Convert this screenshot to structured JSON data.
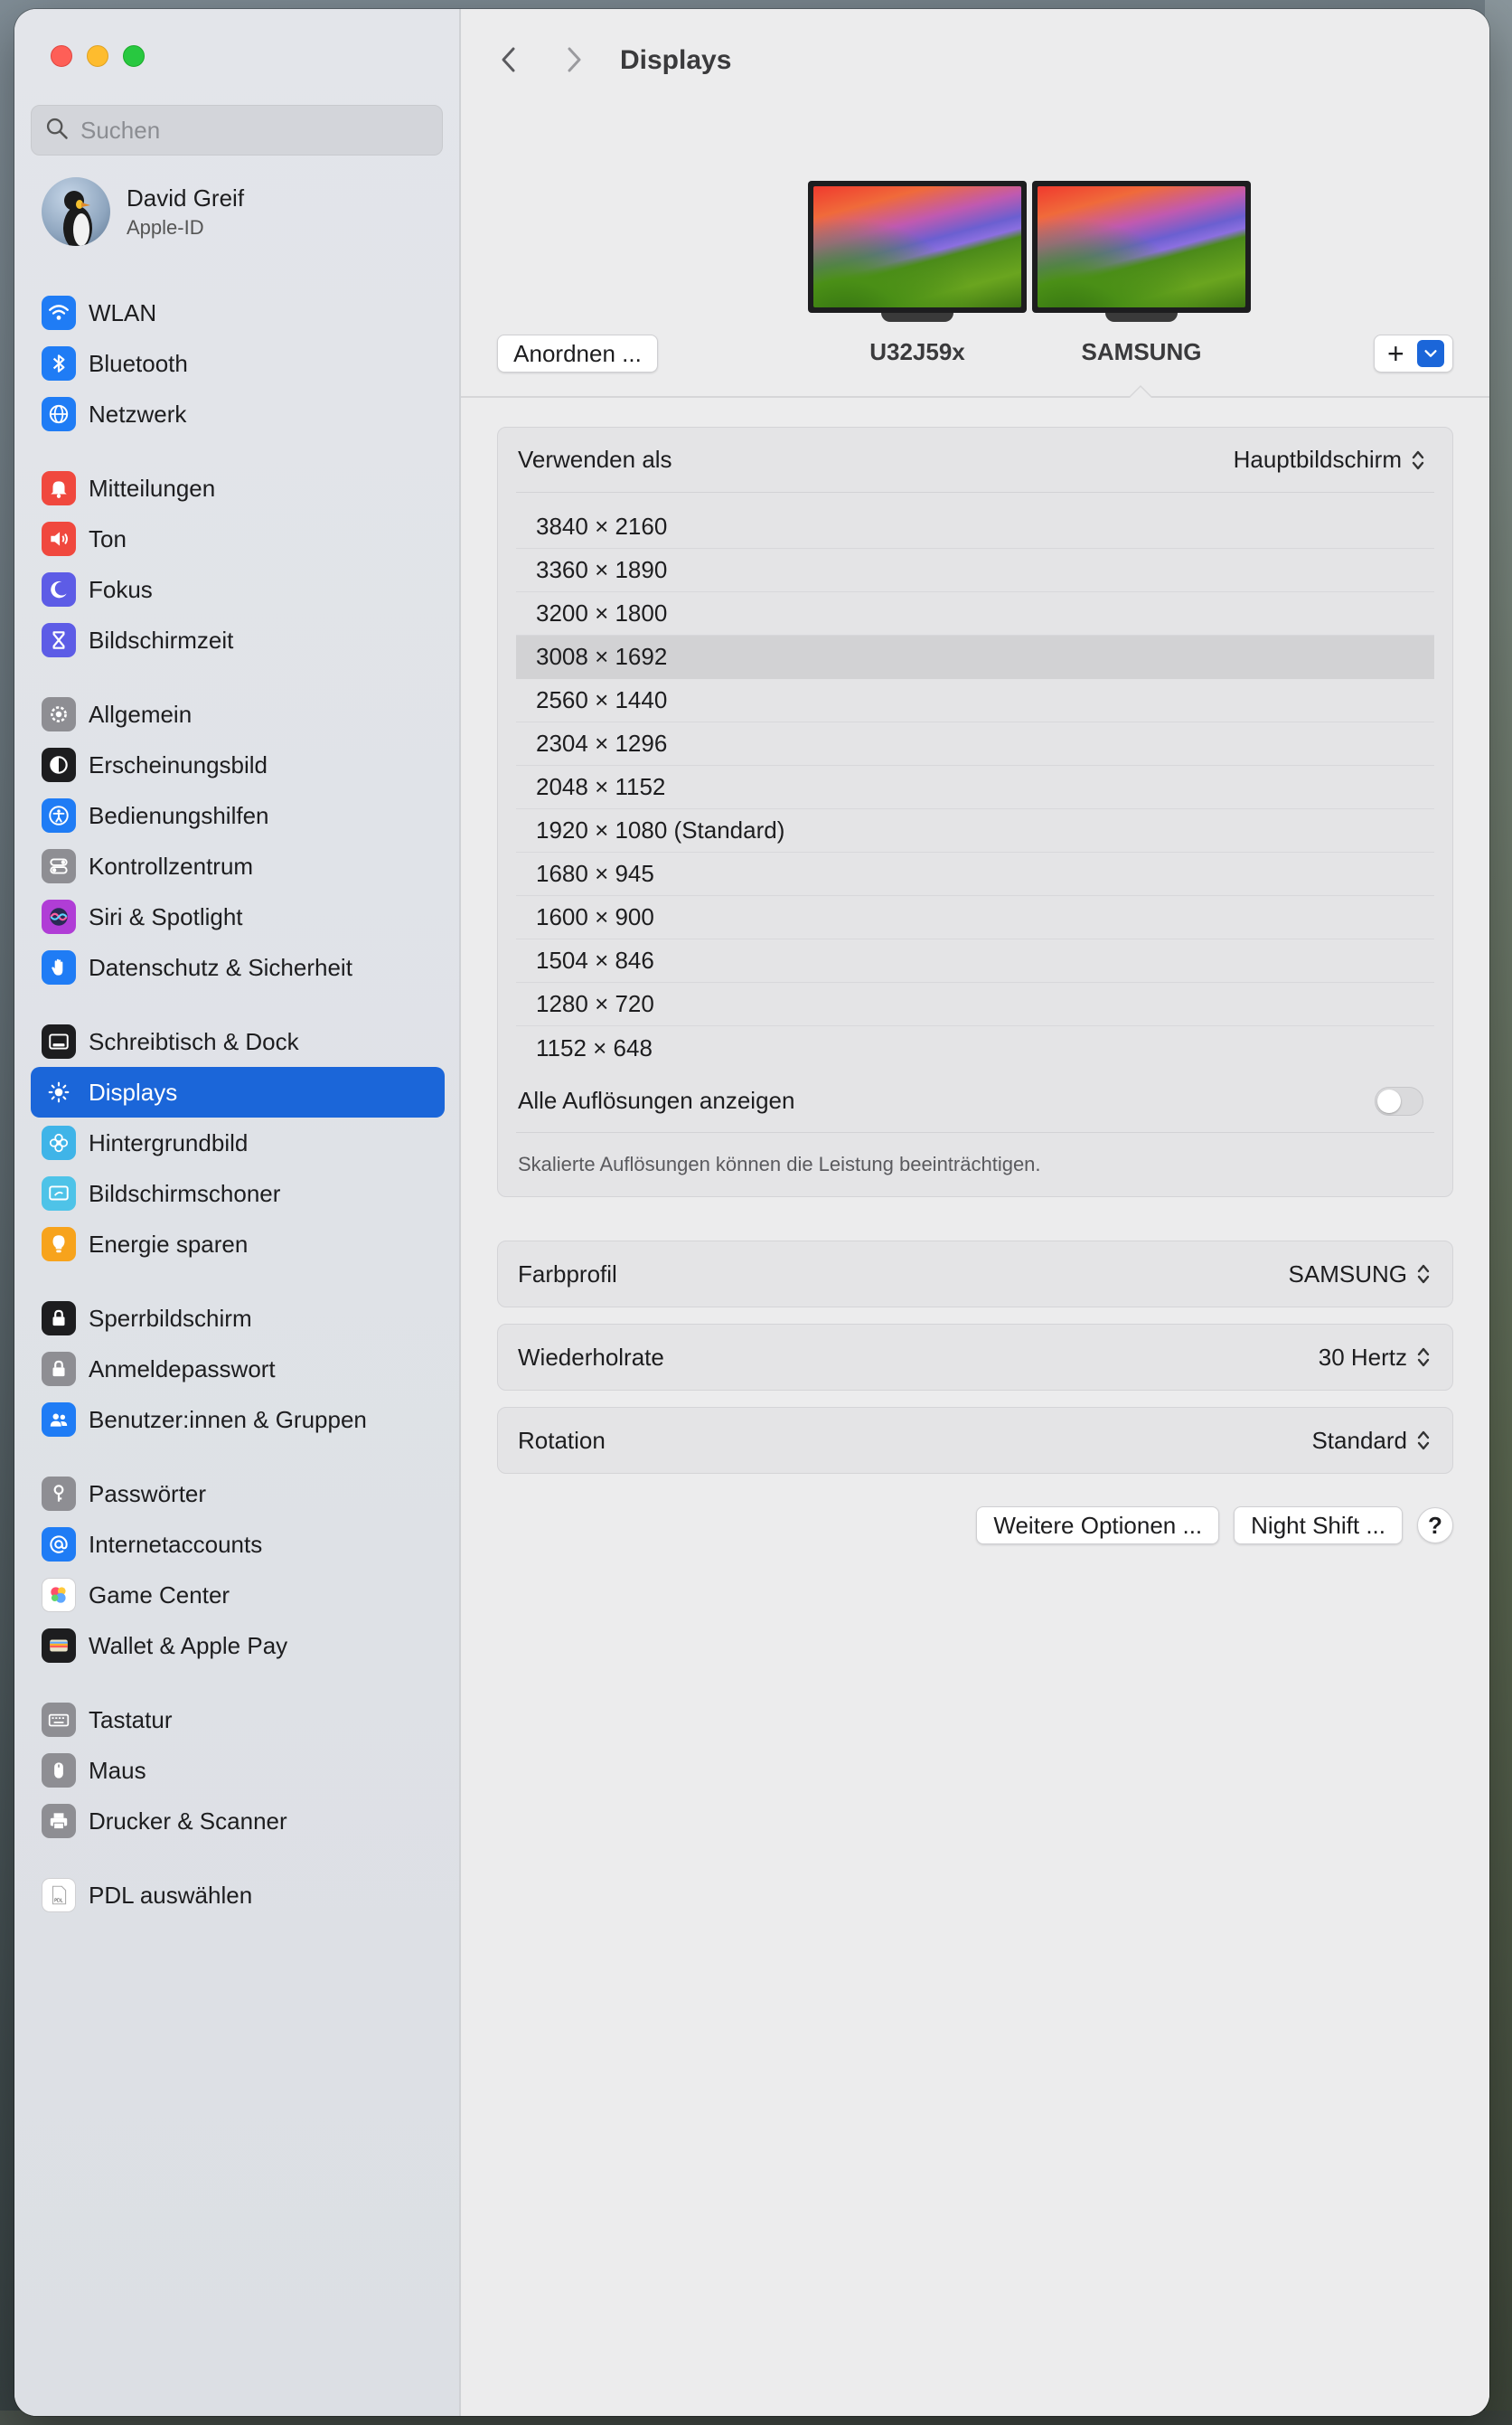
{
  "window": {
    "title": "Displays"
  },
  "search": {
    "placeholder": "Suchen"
  },
  "profile": {
    "name": "David Greif",
    "subtitle": "Apple-ID"
  },
  "sidebar": {
    "groups": [
      [
        {
          "label": "WLAN",
          "icon": "wifi-icon",
          "color": "#1f7cf5"
        },
        {
          "label": "Bluetooth",
          "icon": "bluetooth-icon",
          "color": "#1f7cf5"
        },
        {
          "label": "Netzwerk",
          "icon": "globe-icon",
          "color": "#1f7cf5"
        }
      ],
      [
        {
          "label": "Mitteilungen",
          "icon": "bell-icon",
          "color": "#f0483e"
        },
        {
          "label": "Ton",
          "icon": "speaker-icon",
          "color": "#f0483e"
        },
        {
          "label": "Fokus",
          "icon": "moon-icon",
          "color": "#5d5ce6"
        },
        {
          "label": "Bildschirmzeit",
          "icon": "hourglass-icon",
          "color": "#5d5ce6"
        }
      ],
      [
        {
          "label": "Allgemein",
          "icon": "gear-icon",
          "color": "#8e8e93"
        },
        {
          "label": "Erscheinungsbild",
          "icon": "appearance-icon",
          "color": "#1d1d1f"
        },
        {
          "label": "Bedienungshilfen",
          "icon": "accessibility-icon",
          "color": "#1f7cf5"
        },
        {
          "label": "Kontrollzentrum",
          "icon": "toggles-icon",
          "color": "#8e8e93"
        },
        {
          "label": "Siri & Spotlight",
          "icon": "siri-icon",
          "color": "#b03dd6"
        },
        {
          "label": "Datenschutz & Sicherheit",
          "icon": "hand-icon",
          "color": "#1f7cf5"
        }
      ],
      [
        {
          "label": "Schreibtisch & Dock",
          "icon": "dock-icon",
          "color": "#1d1d1f"
        },
        {
          "label": "Displays",
          "icon": "sun-icon",
          "color": "#1f7cf5",
          "active": true
        },
        {
          "label": "Hintergrundbild",
          "icon": "flower-icon",
          "color": "#3fb4e8"
        },
        {
          "label": "Bildschirmschoner",
          "icon": "screensaver-icon",
          "color": "#4ec3e8"
        },
        {
          "label": "Energie sparen",
          "icon": "bulb-icon",
          "color": "#f7a31c"
        }
      ],
      [
        {
          "label": "Sperrbildschirm",
          "icon": "lock-screen-icon",
          "color": "#1d1d1f"
        },
        {
          "label": "Anmeldepasswort",
          "icon": "lock-icon",
          "color": "#8e8e93"
        },
        {
          "label": "Benutzer:innen & Gruppen",
          "icon": "users-icon",
          "color": "#1f7cf5"
        }
      ],
      [
        {
          "label": "Passwörter",
          "icon": "key-icon",
          "color": "#8e8e93"
        },
        {
          "label": "Internetaccounts",
          "icon": "at-icon",
          "color": "#1f7cf5"
        },
        {
          "label": "Game Center",
          "icon": "gamecenter-icon",
          "color": "#ffffff"
        },
        {
          "label": "Wallet & Apple Pay",
          "icon": "wallet-icon",
          "color": "#1d1d1f"
        }
      ],
      [
        {
          "label": "Tastatur",
          "icon": "keyboard-icon",
          "color": "#8e8e93"
        },
        {
          "label": "Maus",
          "icon": "mouse-icon",
          "color": "#8e8e93"
        },
        {
          "label": "Drucker & Scanner",
          "icon": "printer-icon",
          "color": "#8e8e93"
        }
      ],
      [
        {
          "label": "PDL auswählen",
          "icon": "pdl-icon",
          "color": "#ffffff"
        }
      ]
    ]
  },
  "arrangement": {
    "button": "Anordnen ...",
    "displays": [
      "U32J59x",
      "SAMSUNG"
    ],
    "add_label": "+"
  },
  "use_as": {
    "label": "Verwenden als",
    "value": "Hauptbildschirm"
  },
  "resolutions": {
    "items": [
      "3840 × 2160",
      "3360 × 1890",
      "3200 × 1800",
      "3008 × 1692",
      "2560 × 1440",
      "2304 × 1296",
      "2048 × 1152",
      "1920 × 1080 (Standard)",
      "1680 × 945",
      "1600 × 900",
      "1504 × 846",
      "1280 × 720",
      "1152 × 648"
    ],
    "selected_index": 3,
    "show_all_label": "Alle Auflösungen anzeigen",
    "note": "Skalierte Auflösungen können die Leistung beeinträchtigen."
  },
  "color_profile": {
    "label": "Farbprofil",
    "value": "SAMSUNG"
  },
  "refresh_rate": {
    "label": "Wiederholrate",
    "value": "30 Hertz"
  },
  "rotation": {
    "label": "Rotation",
    "value": "Standard"
  },
  "footer": {
    "more_options": "Weitere Optionen ...",
    "night_shift": "Night Shift ...",
    "help": "?"
  }
}
